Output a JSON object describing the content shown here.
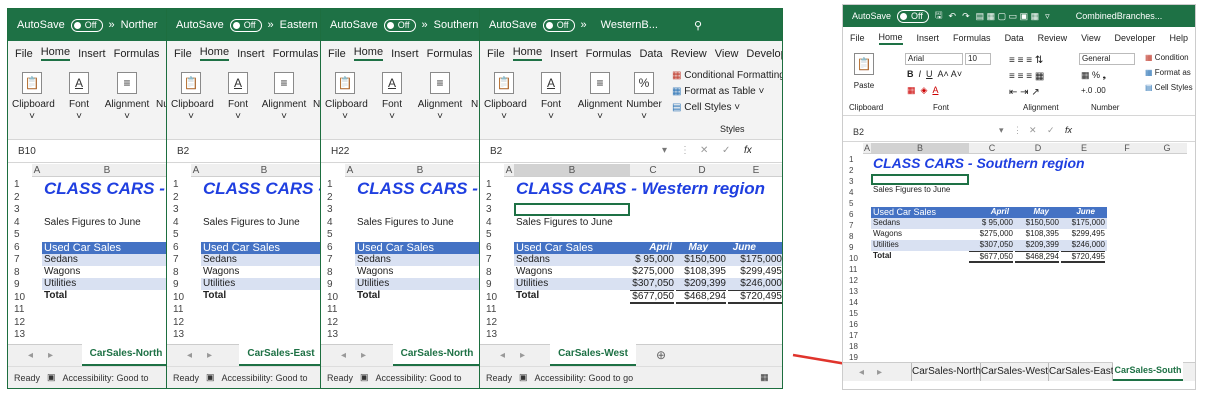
{
  "win1": {
    "autosave": "AutoSave",
    "toggle": "Off",
    "chev": "»",
    "title": "Norther",
    "menu": [
      "File",
      "Home",
      "Insert",
      "Formulas"
    ],
    "groups": [
      "Clipboard",
      "Font",
      "Alignment",
      "Nu"
    ],
    "namebox": "B10",
    "cols": [
      "A",
      "B"
    ],
    "heading": "CLASS CARS -",
    "subtitle": "Sales Figures to June",
    "used": "Used Car Sales",
    "rows": [
      "Sedans",
      "Wagons",
      "Utilities",
      "Total"
    ],
    "tab": "CarSales-North",
    "status": "Ready",
    "access": "Accessibility: Good to"
  },
  "win2": {
    "autosave": "AutoSave",
    "toggle": "Off",
    "chev": "»",
    "title": "Eastern",
    "menu": [
      "File",
      "Home",
      "Insert",
      "Formulas"
    ],
    "groups": [
      "Clipboard",
      "Font",
      "Alignment",
      "N"
    ],
    "namebox": "B2",
    "cols": [
      "A",
      "B"
    ],
    "heading": "CLASS CARS -",
    "subtitle": "Sales Figures to June",
    "used": "Used Car Sales",
    "rows": [
      "Sedans",
      "Wagons",
      "Utilities",
      "Total"
    ],
    "tab": "CarSales-East",
    "status": "Ready",
    "access": "Accessibility: Good to"
  },
  "win3": {
    "autosave": "AutoSave",
    "toggle": "Off",
    "chev": "»",
    "title": "Southern",
    "menu": [
      "File",
      "Home",
      "Insert",
      "Formulas"
    ],
    "groups": [
      "Clipboard",
      "Font",
      "Alignment",
      "N"
    ],
    "namebox": "H22",
    "cols": [
      "A",
      "B"
    ],
    "heading": "CLASS CARS -",
    "subtitle": "Sales Figures to June",
    "used": "Used Car Sales",
    "rows": [
      "Sedans",
      "Wagons",
      "Utilities",
      "Total"
    ],
    "tab": "CarSales-North",
    "status": "Ready",
    "access": "Accessibility: Good to"
  },
  "win4": {
    "autosave": "AutoSave",
    "toggle": "Off",
    "chev": "»",
    "title": "WesternB...",
    "menu": [
      "File",
      "Home",
      "Insert",
      "Formulas",
      "Data",
      "Review",
      "View",
      "Developer"
    ],
    "groups": [
      "Clipboard",
      "Font",
      "Alignment",
      "Number"
    ],
    "styles": [
      "Conditional Formatting ˅",
      "Format as Table ˅",
      "Cell Styles ˅"
    ],
    "styles_label": "Styles",
    "namebox": "B2",
    "cols": [
      "A",
      "B",
      "C",
      "D",
      "E"
    ],
    "heading": "CLASS CARS - Western region",
    "subtitle": "Sales Figures to June",
    "used": "Used Car Sales",
    "months": [
      "April",
      "May",
      "June"
    ],
    "rows": [
      "Sedans",
      "Wagons",
      "Utilities",
      "Total"
    ],
    "values": [
      [
        "$ 95,000",
        "$150,500",
        "$175,000"
      ],
      [
        "$275,000",
        "$108,395",
        "$299,495"
      ],
      [
        "$307,050",
        "$209,399",
        "$246,000"
      ],
      [
        "$677,050",
        "$468,294",
        "$720,495"
      ]
    ],
    "tab": "CarSales-West",
    "status": "Ready",
    "access": "Accessibility: Good to go"
  },
  "win5": {
    "autosave": "AutoSave",
    "toggle": "Off",
    "title": "CombinedBranches...",
    "menu": [
      "File",
      "Home",
      "Insert",
      "Formulas",
      "Data",
      "Review",
      "View",
      "Developer",
      "Help"
    ],
    "font": "Arial",
    "size": "10",
    "numfmt": "General",
    "groups": [
      "Clipboard",
      "Font",
      "Alignment",
      "Number"
    ],
    "paste": "Paste",
    "styles": [
      "Condition",
      "Format as",
      "Cell Styles"
    ],
    "namebox": "B2",
    "cols": [
      "A",
      "B",
      "C",
      "D",
      "E",
      "F",
      "G"
    ],
    "heading": "CLASS CARS - Southern region",
    "subtitle": "Sales Figures to June",
    "used": "Used Car Sales",
    "months": [
      "April",
      "May",
      "June"
    ],
    "rows": [
      "Sedans",
      "Wagons",
      "Utilities",
      "Total"
    ],
    "values": [
      [
        "$ 95,000",
        "$150,500",
        "$175,000"
      ],
      [
        "$275,000",
        "$108,395",
        "$299,495"
      ],
      [
        "$307,050",
        "$209,399",
        "$246,000"
      ],
      [
        "$677,050",
        "$468,294",
        "$720,495"
      ]
    ],
    "tabs": [
      "CarSales-North",
      "CarSales-West",
      "CarSales-East",
      "CarSales-South"
    ]
  },
  "colors": {
    "excel_green": "#1e7145",
    "title_blue": "#1f3fe0",
    "header_blue": "#4472c4",
    "band": "#d9e1f2",
    "arrow": "#e0342c"
  }
}
